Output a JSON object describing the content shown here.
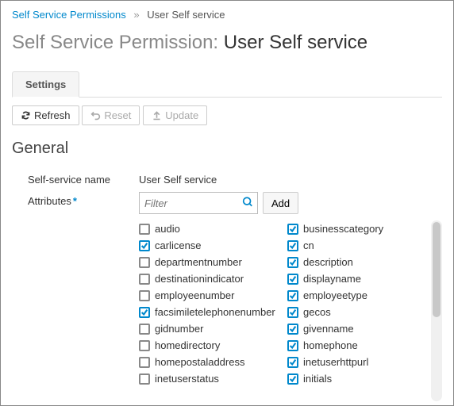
{
  "breadcrumb": {
    "root": "Self Service Permissions",
    "sep": "»",
    "current": "User Self service"
  },
  "title_prefix": "Self Service Permission:",
  "title_entity": "User Self service",
  "tab_label": "Settings",
  "actions": {
    "refresh": "Refresh",
    "reset": "Reset",
    "update": "Update"
  },
  "section_heading": "General",
  "fields": {
    "name_label": "Self-service name",
    "name_value": "User Self service",
    "attr_label": "Attributes"
  },
  "filter_placeholder": "Filter",
  "add_label": "Add",
  "attributes_left": [
    {
      "label": "audio",
      "checked": false
    },
    {
      "label": "carlicense",
      "checked": true
    },
    {
      "label": "departmentnumber",
      "checked": false
    },
    {
      "label": "destinationindicator",
      "checked": false
    },
    {
      "label": "employeenumber",
      "checked": false
    },
    {
      "label": "facsimiletelephonenumber",
      "checked": true
    },
    {
      "label": "gidnumber",
      "checked": false
    },
    {
      "label": "homedirectory",
      "checked": false
    },
    {
      "label": "homepostaladdress",
      "checked": false
    },
    {
      "label": "inetuserstatus",
      "checked": false
    }
  ],
  "attributes_right": [
    {
      "label": "businesscategory",
      "checked": true
    },
    {
      "label": "cn",
      "checked": true
    },
    {
      "label": "description",
      "checked": true
    },
    {
      "label": "displayname",
      "checked": true
    },
    {
      "label": "employeetype",
      "checked": true
    },
    {
      "label": "gecos",
      "checked": true
    },
    {
      "label": "givenname",
      "checked": true
    },
    {
      "label": "homephone",
      "checked": true
    },
    {
      "label": "inetuserhttpurl",
      "checked": true
    },
    {
      "label": "initials",
      "checked": true
    }
  ]
}
